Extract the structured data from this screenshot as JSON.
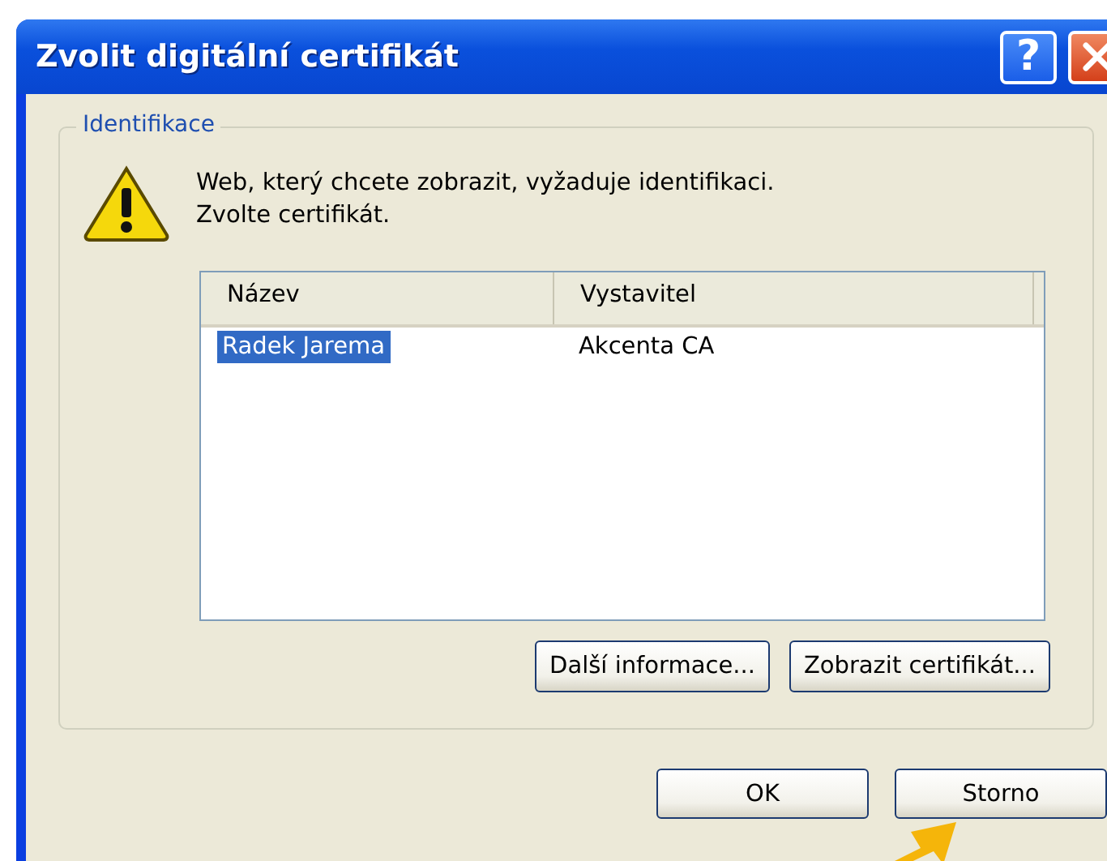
{
  "window": {
    "title": "Zvolit digitální certifikát",
    "title_buttons": [
      {
        "kind": "help",
        "label": "?"
      },
      {
        "kind": "close"
      }
    ]
  },
  "group": {
    "label": "Identifikace",
    "message_lines": [
      "Web, který chcete zobrazit, vyžaduje identifikaci.",
      "Zvolte certifikát."
    ],
    "table": {
      "columns": [
        "Název",
        "Vystavitel"
      ],
      "rows": [
        {
          "cells": [
            "Radek Jarema",
            "Akcenta CA"
          ],
          "selected": true
        }
      ]
    },
    "buttons": [
      "Další informace...",
      "Zobrazit certifikát..."
    ]
  },
  "buttons": [
    "OK",
    "Storno"
  ]
}
